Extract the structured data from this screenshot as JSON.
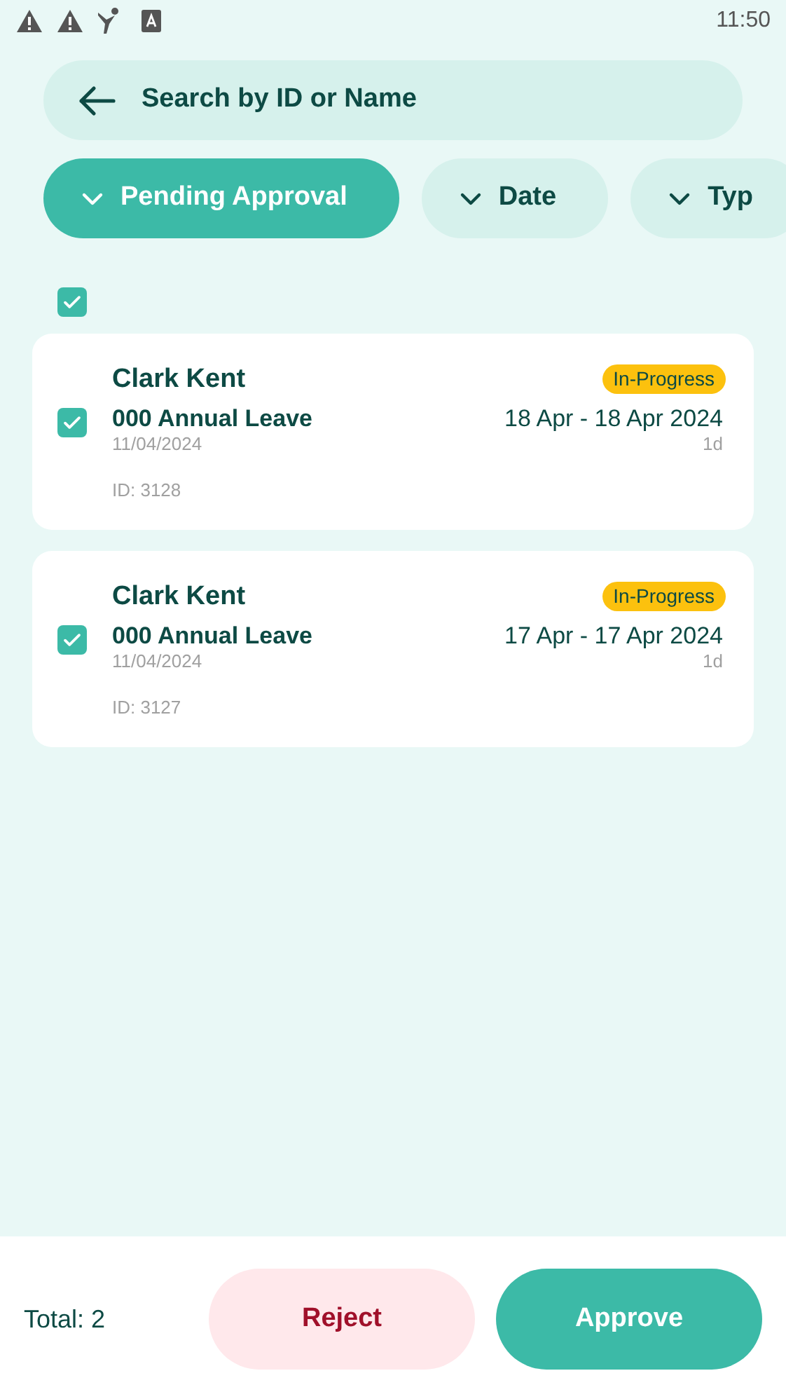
{
  "status_bar": {
    "time": "11:50"
  },
  "search": {
    "placeholder": "Search by ID or Name"
  },
  "filters": [
    {
      "label": "Pending Approval",
      "selected": true
    },
    {
      "label": "Date",
      "selected": false
    },
    {
      "label": "Typ",
      "selected": false
    }
  ],
  "select_all": {
    "checked": true
  },
  "requests": [
    {
      "name": "Clark Kent",
      "status": "In-Progress",
      "type": "000 Annual Leave",
      "dates": "18 Apr - 18 Apr 2024",
      "submitted": "11/04/2024",
      "duration": "1d",
      "id": "ID: 3128",
      "checked": true
    },
    {
      "name": "Clark Kent",
      "status": "In-Progress",
      "type": "000 Annual Leave",
      "dates": "17 Apr - 17 Apr 2024",
      "submitted": "11/04/2024",
      "duration": "1d",
      "id": "ID: 3127",
      "checked": true
    }
  ],
  "footer": {
    "total": "Total: 2",
    "reject": "Reject",
    "approve": "Approve"
  }
}
